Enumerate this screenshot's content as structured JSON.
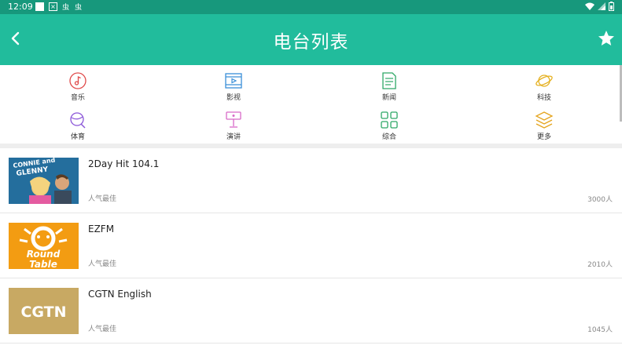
{
  "status": {
    "time": "12:09",
    "icon3": "虫",
    "icon4": "虫"
  },
  "header": {
    "title": "电台列表"
  },
  "categories": [
    {
      "label": "音乐",
      "icon": "music-icon",
      "color": "#e04a4a"
    },
    {
      "label": "影视",
      "icon": "film-icon",
      "color": "#3a8fd8"
    },
    {
      "label": "新闻",
      "icon": "news-icon",
      "color": "#2ea866"
    },
    {
      "label": "科技",
      "icon": "planet-icon",
      "color": "#e5b01f"
    },
    {
      "label": "体育",
      "icon": "sports-icon",
      "color": "#8a55d8"
    },
    {
      "label": "演讲",
      "icon": "lectern-icon",
      "color": "#d86ac8"
    },
    {
      "label": "综合",
      "icon": "grid-icon",
      "color": "#2ea866"
    },
    {
      "label": "更多",
      "icon": "layers-icon",
      "color": "#e5a51f"
    }
  ],
  "stations": [
    {
      "name": "2Day Hit 104.1",
      "subtitle": "人气最佳",
      "count": "3000人",
      "thumb_text": "CONNIE and GLENNY"
    },
    {
      "name": "EZFM",
      "subtitle": "人气最佳",
      "count": "2010人",
      "thumb_text": "Round Table"
    },
    {
      "name": "CGTN English",
      "subtitle": "人气最佳",
      "count": "1045人",
      "thumb_text": "CGTN"
    }
  ],
  "colors": {
    "app_bar": "#21bc9c",
    "status_bar": "#17987c"
  }
}
